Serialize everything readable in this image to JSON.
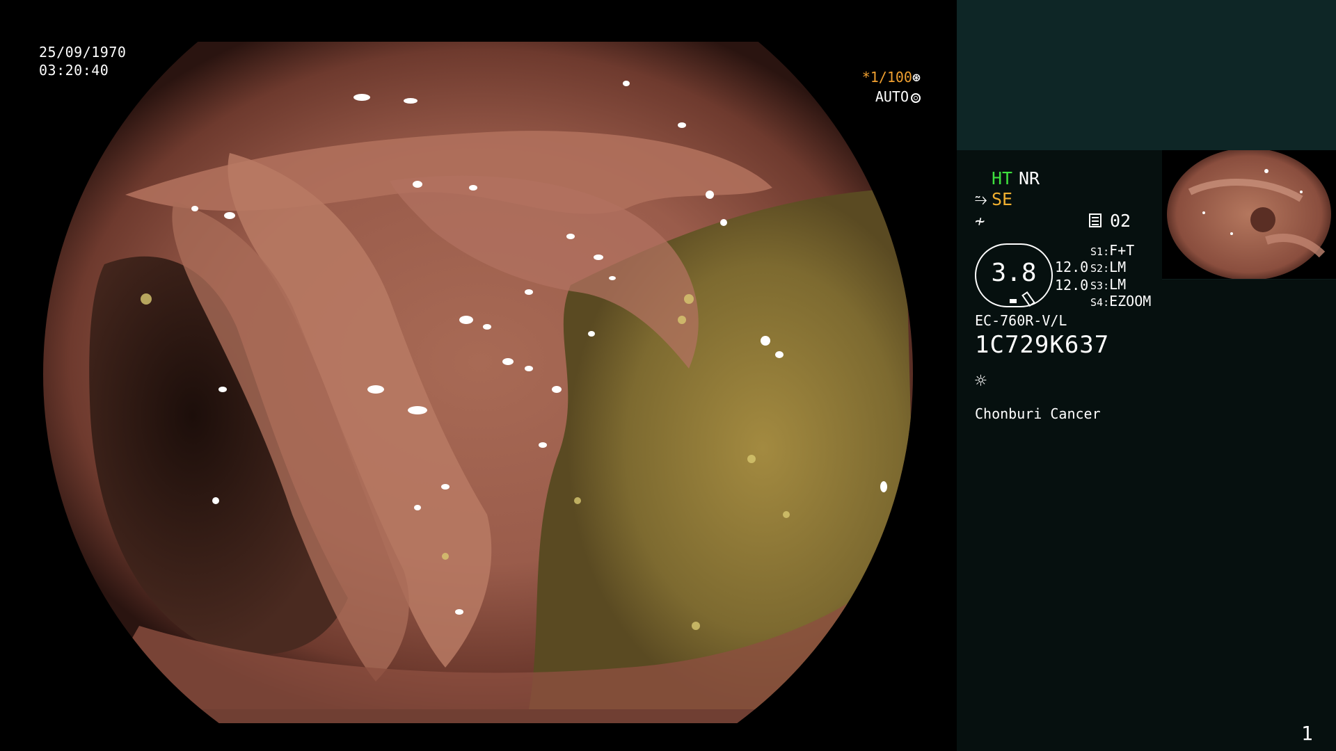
{
  "screen": {
    "date": "25/09/1970",
    "time": "03:20:40",
    "shutter_prefix": "*",
    "shutter_value": "1/100",
    "exposure_mode": "AUTO"
  },
  "panel": {
    "ht_label": "HT",
    "nr_label": "NR",
    "se_label": "SE",
    "memory_value": "02",
    "gauge_value": "3.8",
    "value_1": "12.0",
    "value_2": "12.0",
    "switches": [
      {
        "key": "S1",
        "value": "F+T"
      },
      {
        "key": "S2",
        "value": "LM"
      },
      {
        "key": "S3",
        "value": "LM"
      },
      {
        "key": "S4",
        "value": "EZOOM"
      }
    ],
    "scope_model": "EC-760R-V/L",
    "scope_serial": "1C729K637",
    "site_name": "Chonburi Cancer",
    "page_number": "1"
  },
  "colors": {
    "ht": "#3ee03e",
    "se": "#f0b030",
    "panel_top": "#0e2626",
    "panel_bg": "#06100f"
  },
  "icons": {
    "shutter": "aperture-icon",
    "exposure": "ring-icon",
    "se": "se-scope-icon",
    "mode": "modulation-icon",
    "memory": "memory-card-icon",
    "light": "sun-icon"
  }
}
